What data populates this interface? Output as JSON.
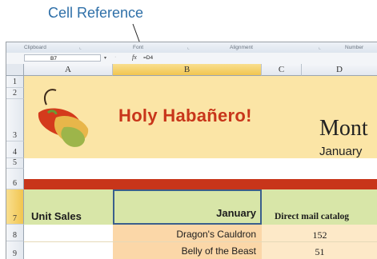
{
  "callout": {
    "label": "Cell Reference"
  },
  "ribbon": {
    "groups": [
      {
        "label": "Clipboard",
        "launcher": "⌞"
      },
      {
        "label": "Font",
        "launcher": "⌞"
      },
      {
        "label": "Alignment",
        "launcher": "⌞"
      },
      {
        "label": "Number",
        "launcher": ""
      }
    ]
  },
  "formula_bar": {
    "name_box": "B7",
    "fx_label": "fx",
    "formula": "=D4"
  },
  "columns": [
    {
      "label": "A",
      "selected": false
    },
    {
      "label": "B",
      "selected": true
    },
    {
      "label": "C",
      "selected": false
    },
    {
      "label": "D",
      "selected": false
    }
  ],
  "rows": [
    {
      "label": "1",
      "selected": false
    },
    {
      "label": "2",
      "selected": false
    },
    {
      "label": "3",
      "selected": false
    },
    {
      "label": "4",
      "selected": false
    },
    {
      "label": "5",
      "selected": false
    },
    {
      "label": "6",
      "selected": false
    },
    {
      "label": "7",
      "selected": true
    },
    {
      "label": "8",
      "selected": false
    },
    {
      "label": "9",
      "selected": false
    }
  ],
  "sheet": {
    "brand_title": "Holy Habañero!",
    "month_title": "Mont",
    "month_subtitle": "January",
    "row7": {
      "a": "Unit Sales",
      "b": "January",
      "c": "Direct mail catalog"
    },
    "products": [
      {
        "name": "Dragon's Cauldron",
        "direct_mail": "152"
      },
      {
        "name": "Belly of the Beast",
        "direct_mail": "51"
      }
    ]
  },
  "colors": {
    "accent_blue": "#2e6fa8",
    "brand_red": "#c8351a",
    "banner_yellow": "#fbe5a6",
    "header_green": "#d8e6a8",
    "selection_border": "#3a5f8c"
  }
}
